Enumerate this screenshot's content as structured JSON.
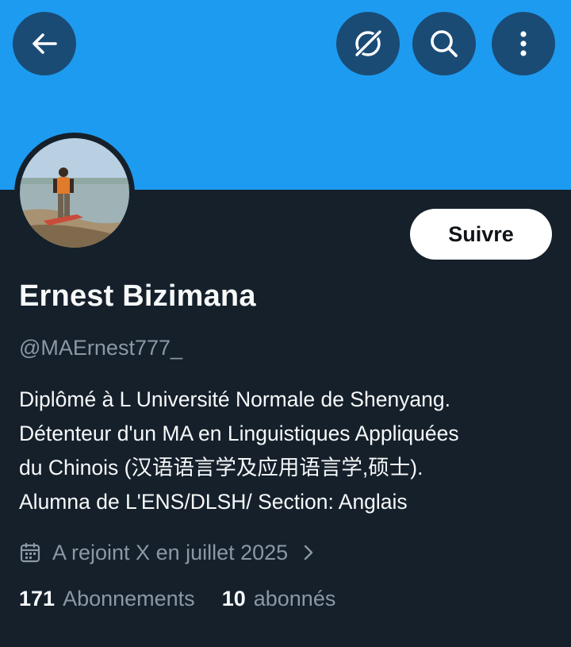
{
  "colors": {
    "banner": "#1d9bf0",
    "background": "#15202b",
    "icon_button_bg": "#1a4b75",
    "secondary_text": "#8b98a5",
    "primary_text": "#f7f9f9",
    "follow_button_bg": "#ffffff"
  },
  "header": {
    "icons": [
      "back-arrow-icon",
      "grok-icon",
      "search-icon",
      "more-vertical-icon"
    ]
  },
  "profile": {
    "name": "Ernest Bizimana",
    "handle": "@MAErnest777_",
    "follow_label": "Suivre",
    "bio_lines": [
      "Diplômé à L Université Normale de Shenyang.",
      "Détenteur d'un MA en Linguistiques Appliquées",
      "du Chinois (汉语语言学及应用语言学,硕士).",
      "Alumna de L'ENS/DLSH/ Section: Anglais"
    ],
    "joined_text": "A rejoint X en juillet 2025",
    "following_count": "171",
    "following_label": "Abonnements",
    "followers_count": "10",
    "followers_label": "abonnés"
  }
}
